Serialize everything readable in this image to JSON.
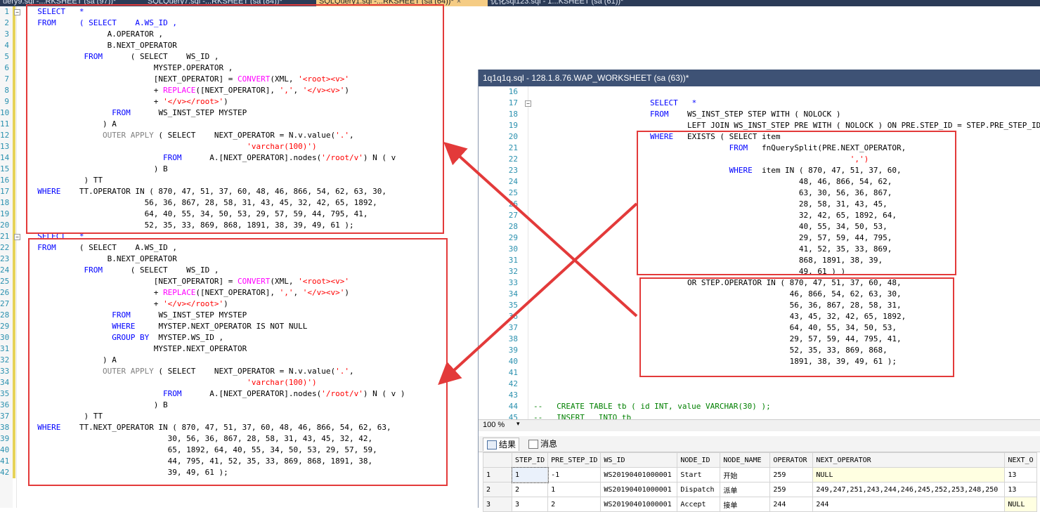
{
  "tabs": [
    {
      "label": "uery9.sql -...RKSHEET (sa (97))*",
      "active": false
    },
    {
      "label": "SQLQuery7.sql -...RKSHEET (sa (84))*",
      "active": false
    },
    {
      "label": "SQLQuery1.sql -...RKSHEET (sa (64))*",
      "active": true
    },
    {
      "label": "优化sql123.sql - 1...KSHEET (sa (61))*",
      "active": false
    }
  ],
  "left_editor": {
    "line_numbers": [
      "1",
      "2",
      "3",
      "4",
      "5",
      "6",
      "7",
      "8",
      "9",
      "10",
      "11",
      "12",
      "13",
      "14",
      "15",
      "16",
      "17",
      "18",
      "19",
      "20",
      "21",
      "22",
      "23",
      "24",
      "25",
      "26",
      "27",
      "28",
      "29",
      "30",
      "31",
      "32",
      "33",
      "34",
      "35",
      "36",
      "37",
      "38",
      "39",
      "40",
      "41",
      "42"
    ]
  },
  "right_window": {
    "title": "1q1q1q.sql - 128.1.8.76.WAP_WORKSHEET (sa (63))*",
    "line_numbers": [
      "16",
      "17",
      "18",
      "19",
      "20",
      "21",
      "22",
      "23",
      "24",
      "25",
      "26",
      "27",
      "28",
      "29",
      "30",
      "31",
      "32",
      "33",
      "34",
      "35",
      "36",
      "37",
      "38",
      "39",
      "40",
      "41",
      "42",
      "43",
      "44",
      "45"
    ],
    "zoom": "100 %",
    "result_tabs": [
      {
        "label": "结果",
        "icon": "grid-icon"
      },
      {
        "label": "消息",
        "icon": "message-icon"
      }
    ],
    "results": {
      "columns": [
        "STEP_ID",
        "PRE_STEP_ID",
        "WS_ID",
        "NODE_ID",
        "NODE_NAME",
        "OPERATOR",
        "NEXT_OPERATOR",
        "NEXT_O"
      ],
      "rows": [
        {
          "rn": "1",
          "cells": [
            "1",
            "-1",
            "WS20190401000001",
            "Start",
            "开始",
            "259",
            "NULL",
            "13"
          ]
        },
        {
          "rn": "2",
          "cells": [
            "2",
            "1",
            "WS20190401000001",
            "Dispatch",
            "派单",
            "259",
            "249,247,251,243,244,246,245,252,253,248,250",
            "13"
          ]
        },
        {
          "rn": "3",
          "cells": [
            "3",
            "2",
            "WS20190401000001",
            "Accept",
            "接单",
            "244",
            "244",
            "NULL"
          ]
        }
      ]
    }
  },
  "code": {
    "l1": "  SELECT   *",
    "l2a": "  FROM",
    "l2b": "     ( SELECT    A.WS_ID ,",
    "l3": "                 A.OPERATOR ,",
    "l4": "                 B.NEXT_OPERATOR",
    "l5a": "            FROM",
    "l5b": "      ( SELECT    WS_ID ,",
    "l6": "                           MYSTEP.OPERATOR ,",
    "l7a": "                           [NEXT_OPERATOR] = ",
    "l7b": "CONVERT",
    "l7c": "(XML, ",
    "l7d": "'<root><v>'",
    "l8a": "                           + ",
    "l8b": "REPLACE",
    "l8c": "([NEXT_OPERATOR], ",
    "l8d": "','",
    "l8e": ", ",
    "l8f": "'</v><v>'",
    "l8g": ")",
    "l9a": "                           + ",
    "l9b": "'</v></root>'",
    "l9c": ")",
    "l10a": "                  FROM",
    "l10b": "      WS_INST_STEP MYSTEP",
    "l11": "                ) A",
    "l12a": "                OUTER APPLY",
    "l12b": " ( SELECT    NEXT_OPERATOR = N.v.value(",
    "l12c": "'.'",
    "l12d": ",",
    "l13": "                                               'varchar(100)')",
    "l14a": "                             FROM",
    "l14b": "      A.[NEXT_OPERATOR].nodes(",
    "l14c": "'/root/v'",
    "l14d": ") N ( v",
    "l15": "                           ) B",
    "l16": "            ) TT",
    "l17a": "  WHERE",
    "l17b": "    TT.OPERATOR IN ( 870, 47, 51, 37, 60, 48, 46, 866, 54, 62, 63, 30,",
    "l18": "                         56, 36, 867, 28, 58, 31, 43, 45, 32, 42, 65, 1892,",
    "l19": "                         64, 40, 55, 34, 50, 53, 29, 57, 59, 44, 795, 41,",
    "l20": "                         52, 35, 33, 869, 868, 1891, 38, 39, 49, 61 );",
    "l21": "  SELECT   *",
    "l22a": "  FROM",
    "l22b": "     ( SELECT    A.WS_ID ,",
    "l23": "                 B.NEXT_OPERATOR",
    "l24a": "            FROM",
    "l24b": "      ( SELECT    WS_ID ,",
    "l25": "                           [NEXT_OPERATOR] = ",
    "l26": "                           + ",
    "l27": "                           + ",
    "l28a": "                  FROM",
    "l28b": "      WS_INST_STEP MYSTEP",
    "l29a": "                  WHERE",
    "l29b": "     MYSTEP.NEXT_OPERATOR IS NOT NULL",
    "l30a": "                  GROUP BY",
    "l30b": "  MYSTEP.WS_ID ,",
    "l31": "                           MYSTEP.NEXT_OPERATOR",
    "l32": "                ) A",
    "l33": "                OUTER APPLY",
    "l34": "                                               'varchar(100)')",
    "l35a": "                             FROM",
    "l35b": "      A.[NEXT_OPERATOR].nodes(",
    "l35c": "'/root/v'",
    "l35d": ") N ( v )",
    "l36": "                           ) B",
    "l37": "            ) TT",
    "l38a": "  WHERE",
    "l38b": "    TT.NEXT_OPERATOR IN ( 870, 47, 51, 37, 60, 48, 46, 866, 54, 62, 63,",
    "l39": "                              30, 56, 36, 867, 28, 58, 31, 43, 45, 32, 42,",
    "l40": "                              65, 1892, 64, 40, 55, 34, 50, 53, 29, 57, 59,",
    "l41": "                              44, 795, 41, 52, 35, 33, 869, 868, 1891, 38,",
    "l42": "                              39, 49, 61 );",
    "r17": "SELECT   *",
    "r18a": "FROM",
    "r18b": "    WS_INST_STEP STEP WITH ( NOLOCK )",
    "r19": "        LEFT JOIN WS_INST_STEP PRE WITH ( NOLOCK ) ON PRE.STEP_ID = STEP.PRE_STEP_ID",
    "r20a": "WHERE",
    "r20b": "   EXISTS ( SELECT item",
    "r21a": "                 FROM",
    "r21b": "   fnQuerySplit(PRE.NEXT_OPERATOR,",
    "r22": "                                           ',')",
    "r23a": "                 WHERE",
    "r23b": "  item IN ( 870, 47, 51, 37, 60,",
    "r24": "                                48, 46, 866, 54, 62,",
    "r25": "                                63, 30, 56, 36, 867,",
    "r26": "                                28, 58, 31, 43, 45,",
    "r27": "                                32, 42, 65, 1892, 64,",
    "r28": "                                40, 55, 34, 50, 53,",
    "r29": "                                29, 57, 59, 44, 795,",
    "r30": "                                41, 52, 35, 33, 869,",
    "r31": "                                868, 1891, 38, 39,",
    "r32": "                                49, 61 ) )",
    "r33": "        OR STEP.OPERATOR IN ( 870, 47, 51, 37, 60, 48,",
    "r34": "                              46, 866, 54, 62, 63, 30,",
    "r35": "                              56, 36, 867, 28, 58, 31,",
    "r36": "                              43, 45, 32, 42, 65, 1892,",
    "r37": "                              64, 40, 55, 34, 50, 53,",
    "r38": "                              29, 57, 59, 44, 795, 41,",
    "r39": "                              52, 35, 33, 869, 868,",
    "r40": "                              1891, 38, 39, 49, 61 );",
    "r44": "--   CREATE TABLE tb ( id INT, value VARCHAR(30) );",
    "r45": "--   INSERT   INTO tb"
  },
  "colors": {
    "highlight": "#e33a3a",
    "keyword": "#0000ff",
    "function": "#ff00ff",
    "string": "#ff0000",
    "comment": "#008000"
  }
}
